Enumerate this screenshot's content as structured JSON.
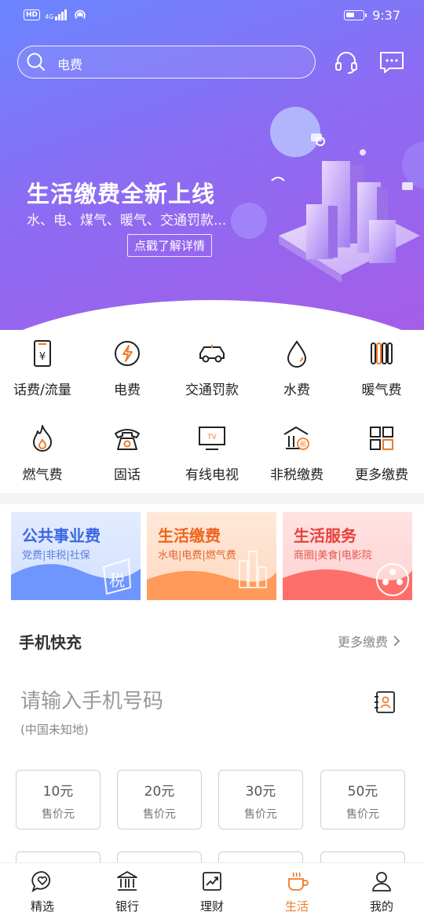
{
  "status_bar": {
    "hd": "HD",
    "signal": "4G",
    "time": "9:37",
    "battery_level": 0.55
  },
  "search": {
    "value": "电费"
  },
  "banner": {
    "title": "生活缴费全新上线",
    "subtitle": "水、电、煤气、暖气、交通罚款...",
    "button": "点戳了解详情"
  },
  "categories": [
    {
      "label": "话费/流量",
      "icon": "phone-bill-icon"
    },
    {
      "label": "电费",
      "icon": "electricity-icon"
    },
    {
      "label": "交通罚款",
      "icon": "car-icon"
    },
    {
      "label": "水费",
      "icon": "water-drop-icon"
    },
    {
      "label": "暖气费",
      "icon": "radiator-icon"
    },
    {
      "label": "燃气费",
      "icon": "flame-icon"
    },
    {
      "label": "固话",
      "icon": "landline-phone-icon"
    },
    {
      "label": "有线电视",
      "icon": "tv-icon"
    },
    {
      "label": "非税缴费",
      "icon": "tax-building-icon"
    },
    {
      "label": "更多缴费",
      "icon": "grid-more-icon"
    }
  ],
  "promos": [
    {
      "title": "公共事业费",
      "subtitle": "党费|非税|社保",
      "title_color": "#3b66e6",
      "art_text": "税"
    },
    {
      "title": "生活缴费",
      "subtitle": "水电|电费|燃气费",
      "title_color": "#f0631c"
    },
    {
      "title": "生活服务",
      "subtitle": "商圈|美食|电影院",
      "title_color": "#e8413a"
    }
  ],
  "recharge": {
    "title": "手机快充",
    "more": "更多缴费",
    "placeholder": "请输入手机号码",
    "region": "(中国未知地)",
    "amounts": [
      {
        "value": "10元",
        "price": "售价元"
      },
      {
        "value": "20元",
        "price": "售价元"
      },
      {
        "value": "30元",
        "price": "售价元"
      },
      {
        "value": "50元",
        "price": "售价元"
      }
    ]
  },
  "nav": [
    {
      "label": "精选",
      "icon": "chat-heart-icon",
      "active": false
    },
    {
      "label": "银行",
      "icon": "bank-icon",
      "active": false
    },
    {
      "label": "理财",
      "icon": "chart-up-icon",
      "active": false
    },
    {
      "label": "生活",
      "icon": "coffee-cup-icon",
      "active": true
    },
    {
      "label": "我的",
      "icon": "user-icon",
      "active": false
    }
  ],
  "colors": {
    "accent": "#f07a2a",
    "hero_start": "#6a86ff",
    "hero_end": "#a55de8"
  }
}
